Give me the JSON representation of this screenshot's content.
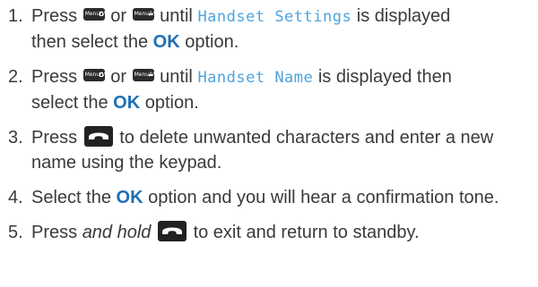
{
  "steps": [
    {
      "number": "1.",
      "press": "Press",
      "or": "or",
      "until": "until",
      "display": "Handset Settings",
      "is_displayed": "is displayed",
      "then_select_the": "then select the",
      "ok": "OK",
      "option": "option."
    },
    {
      "number": "2.",
      "press": "Press",
      "or": "or",
      "until": "until",
      "display": "Handset Name",
      "is_displayed": "is displayed then",
      "then_select_the": "select the",
      "ok": "OK",
      "option": "option."
    },
    {
      "number": "3.",
      "press": "Press",
      "text": "to delete unwanted characters and enter a new name using the keypad."
    },
    {
      "number": "4.",
      "select_the": "Select the",
      "ok": "OK",
      "text": "option and you will hear a confirmation tone."
    },
    {
      "number": "5.",
      "press": "Press",
      "and_hold": "and hold",
      "text": "to exit and return to standby."
    }
  ],
  "key_label": "Menu/Vol",
  "icons": {
    "menu_up": "menu-vol-up-key-icon",
    "menu_down": "menu-vol-down-key-icon",
    "end_call": "end-call-key-icon"
  },
  "colors": {
    "text": "#3a3a3a",
    "lcd_text": "#4da3de",
    "ok": "#1f6fb5",
    "key": "#222222"
  }
}
